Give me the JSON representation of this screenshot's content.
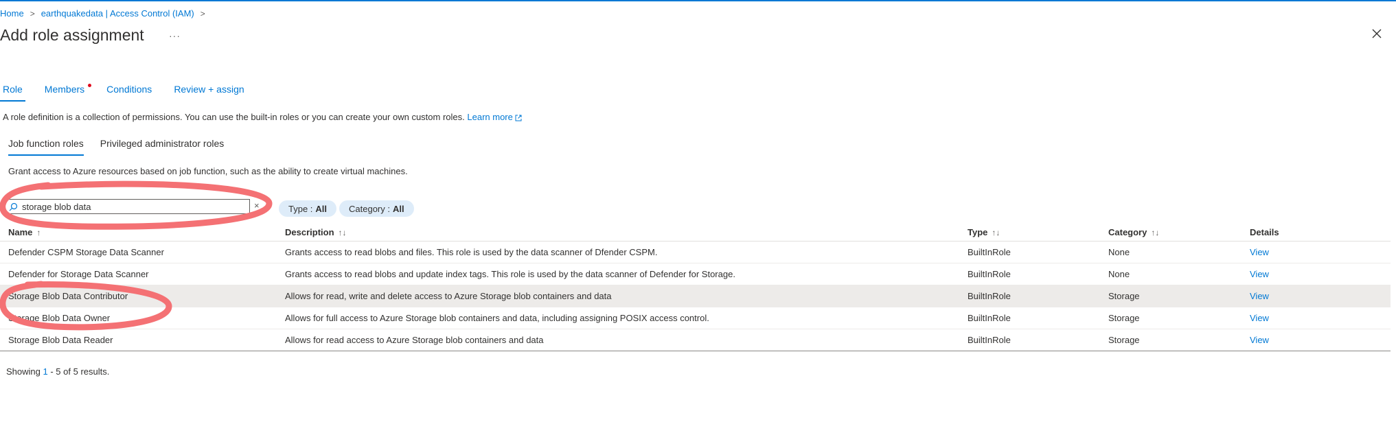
{
  "breadcrumb": {
    "home": "Home",
    "resource": "earthquakedata | Access Control (IAM)"
  },
  "page": {
    "title": "Add role assignment",
    "more": "···"
  },
  "tabs": [
    "Role",
    "Members",
    "Conditions",
    "Review + assign"
  ],
  "description": {
    "text": "A role definition is a collection of permissions. You can use the built-in roles or you can create your own custom roles.",
    "link": "Learn more"
  },
  "subtabs": [
    "Job function roles",
    "Privileged administrator roles"
  ],
  "grant_text": "Grant access to Azure resources based on job function, such as the ability to create virtual machines.",
  "search": {
    "value": "storage blob data",
    "clear": "×"
  },
  "filters": {
    "type_label": "Type :",
    "type_value": "All",
    "category_label": "Category :",
    "category_value": "All"
  },
  "table": {
    "headers": [
      "Name",
      "Description",
      "Type",
      "Category",
      "Details"
    ],
    "sort_icons": [
      "↑",
      "↑↓",
      "↑↓",
      "↑↓"
    ],
    "rows": [
      {
        "name": "Defender CSPM Storage Data Scanner",
        "description": "Grants access to read blobs and files. This role is used by the data scanner of Dfender CSPM.",
        "type": "BuiltInRole",
        "category": "None",
        "details": "View"
      },
      {
        "name": "Defender for Storage Data Scanner",
        "description": "Grants access to read blobs and update index tags. This role is used by the data scanner of Defender for Storage.",
        "type": "BuiltInRole",
        "category": "None",
        "details": "View"
      },
      {
        "name": "Storage Blob Data Contributor",
        "description": "Allows for read, write and delete access to Azure Storage blob containers and data",
        "type": "BuiltInRole",
        "category": "Storage",
        "details": "View"
      },
      {
        "name": "Storage Blob Data Owner",
        "description": "Allows for full access to Azure Storage blob containers and data, including assigning POSIX access control.",
        "type": "BuiltInRole",
        "category": "Storage",
        "details": "View"
      },
      {
        "name": "Storage Blob Data Reader",
        "description": "Allows for read access to Azure Storage blob containers and data",
        "type": "BuiltInRole",
        "category": "Storage",
        "details": "View"
      }
    ]
  },
  "showing": {
    "prefix": "Showing",
    "start": "1",
    "mid": "- 5 of 5 results."
  },
  "colors": {
    "accent": "#0078d4",
    "pill": "#deecf9",
    "selected_row": "#edebe9",
    "annotation": "#f47174"
  }
}
